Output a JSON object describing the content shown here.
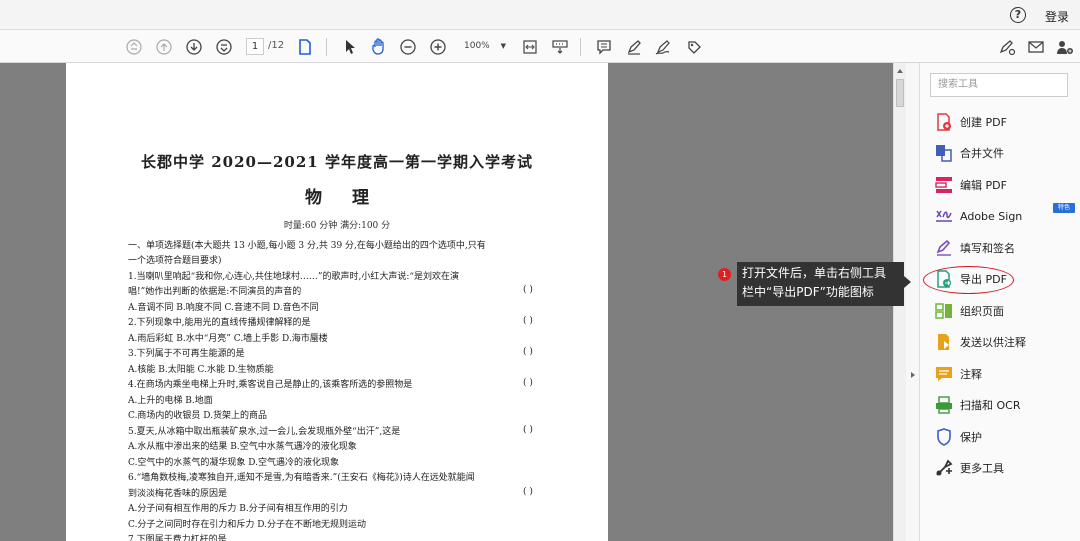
{
  "header": {
    "help_icon": "?",
    "login": "登录"
  },
  "toolbar": {
    "page_current": "1",
    "page_total": "/12",
    "zoom": "100%"
  },
  "document": {
    "title": "长郡中学 2020—2021 学年度高一第一学期入学考试",
    "subject": "物理",
    "meta": "时量:60 分钟      满分:100 分",
    "lines": [
      "一、单项选择题(本大题共 13 小题,每小题 3 分,共 39 分,在每小题给出的四个选项中,只有",
      "一个选项符合题目要求)",
      "1.当喇叭里响起“我和你,心连心,共住地球村……”的歌声时,小红大声说:“是刘欢在演",
      "   唱!”她作出判断的依据是:不同演员的声音的",
      "   A.音调不同          B.响度不同          C.音速不同          D.音色不同",
      "2.下列现象中,能用光的直线传播规律解释的是",
      "   A.雨后彩虹          B.水中“月亮”        C.墙上手影          D.海市蜃楼",
      "3.下列属于不可再生能源的是",
      "   A.核能              B.太阳能            C.水能              D.生物质能",
      "4.在商场内乘坐电梯上升时,乘客说自己是静止的,该乘客所选的参照物是",
      "   A.上升的电梯                            B.地面",
      "   C.商场内的收银员                        D.货架上的商品",
      "5.夏天,从冰箱中取出瓶装矿泉水,过一会儿,会发现瓶外壁“出汗”,这是",
      "   A.水从瓶中渗出来的结果                  B.空气中水蒸气遇冷的液化现象",
      "   C.空气中的水蒸气的凝华现象              D.空气遇冷的液化现象",
      "6.“墙角数枝梅,凌寒独自开,遥知不是雪,为有暗香来.”(王安石《梅花》)诗人在远处就能闻",
      "   到淡淡梅花香味的原因是",
      "   A.分子间有相互作用的斥力                B.分子间有相互作用的引力",
      "   C.分子之间同时存在引力和斥力            D.分子在不断地无规则运动",
      "7.下图属于费力杠杆的是"
    ],
    "paren": "(      )"
  },
  "panel": {
    "search_placeholder": "搜索工具",
    "badge": "特色",
    "tools": [
      {
        "label": "创建 PDF",
        "icon": "create-pdf-icon",
        "color": "#e0393e"
      },
      {
        "label": "合并文件",
        "icon": "combine-files-icon",
        "color": "#3f5fb8"
      },
      {
        "label": "编辑 PDF",
        "icon": "edit-pdf-icon",
        "color": "#d9245d"
      },
      {
        "label": "Adobe Sign",
        "icon": "adobe-sign-icon",
        "color": "#6a45b0"
      },
      {
        "label": "填写和签名",
        "icon": "fill-sign-icon",
        "color": "#7b4fb7"
      },
      {
        "label": "导出 PDF",
        "icon": "export-pdf-icon",
        "color": "#24a07e"
      },
      {
        "label": "组织页面",
        "icon": "organize-pages-icon",
        "color": "#70b43a"
      },
      {
        "label": "发送以供注释",
        "icon": "send-comment-icon",
        "color": "#e6a319"
      },
      {
        "label": "注释",
        "icon": "comment-icon",
        "color": "#e6a319"
      },
      {
        "label": "扫描和 OCR",
        "icon": "scan-ocr-icon",
        "color": "#3d9a3a"
      },
      {
        "label": "保护",
        "icon": "protect-icon",
        "color": "#3a5fc8"
      },
      {
        "label": "更多工具",
        "icon": "more-tools-icon",
        "color": "#333333"
      }
    ]
  },
  "callout": {
    "number": "1",
    "line1": "打开文件后，单击右侧工具",
    "line2": "栏中“导出PDF”功能图标"
  }
}
